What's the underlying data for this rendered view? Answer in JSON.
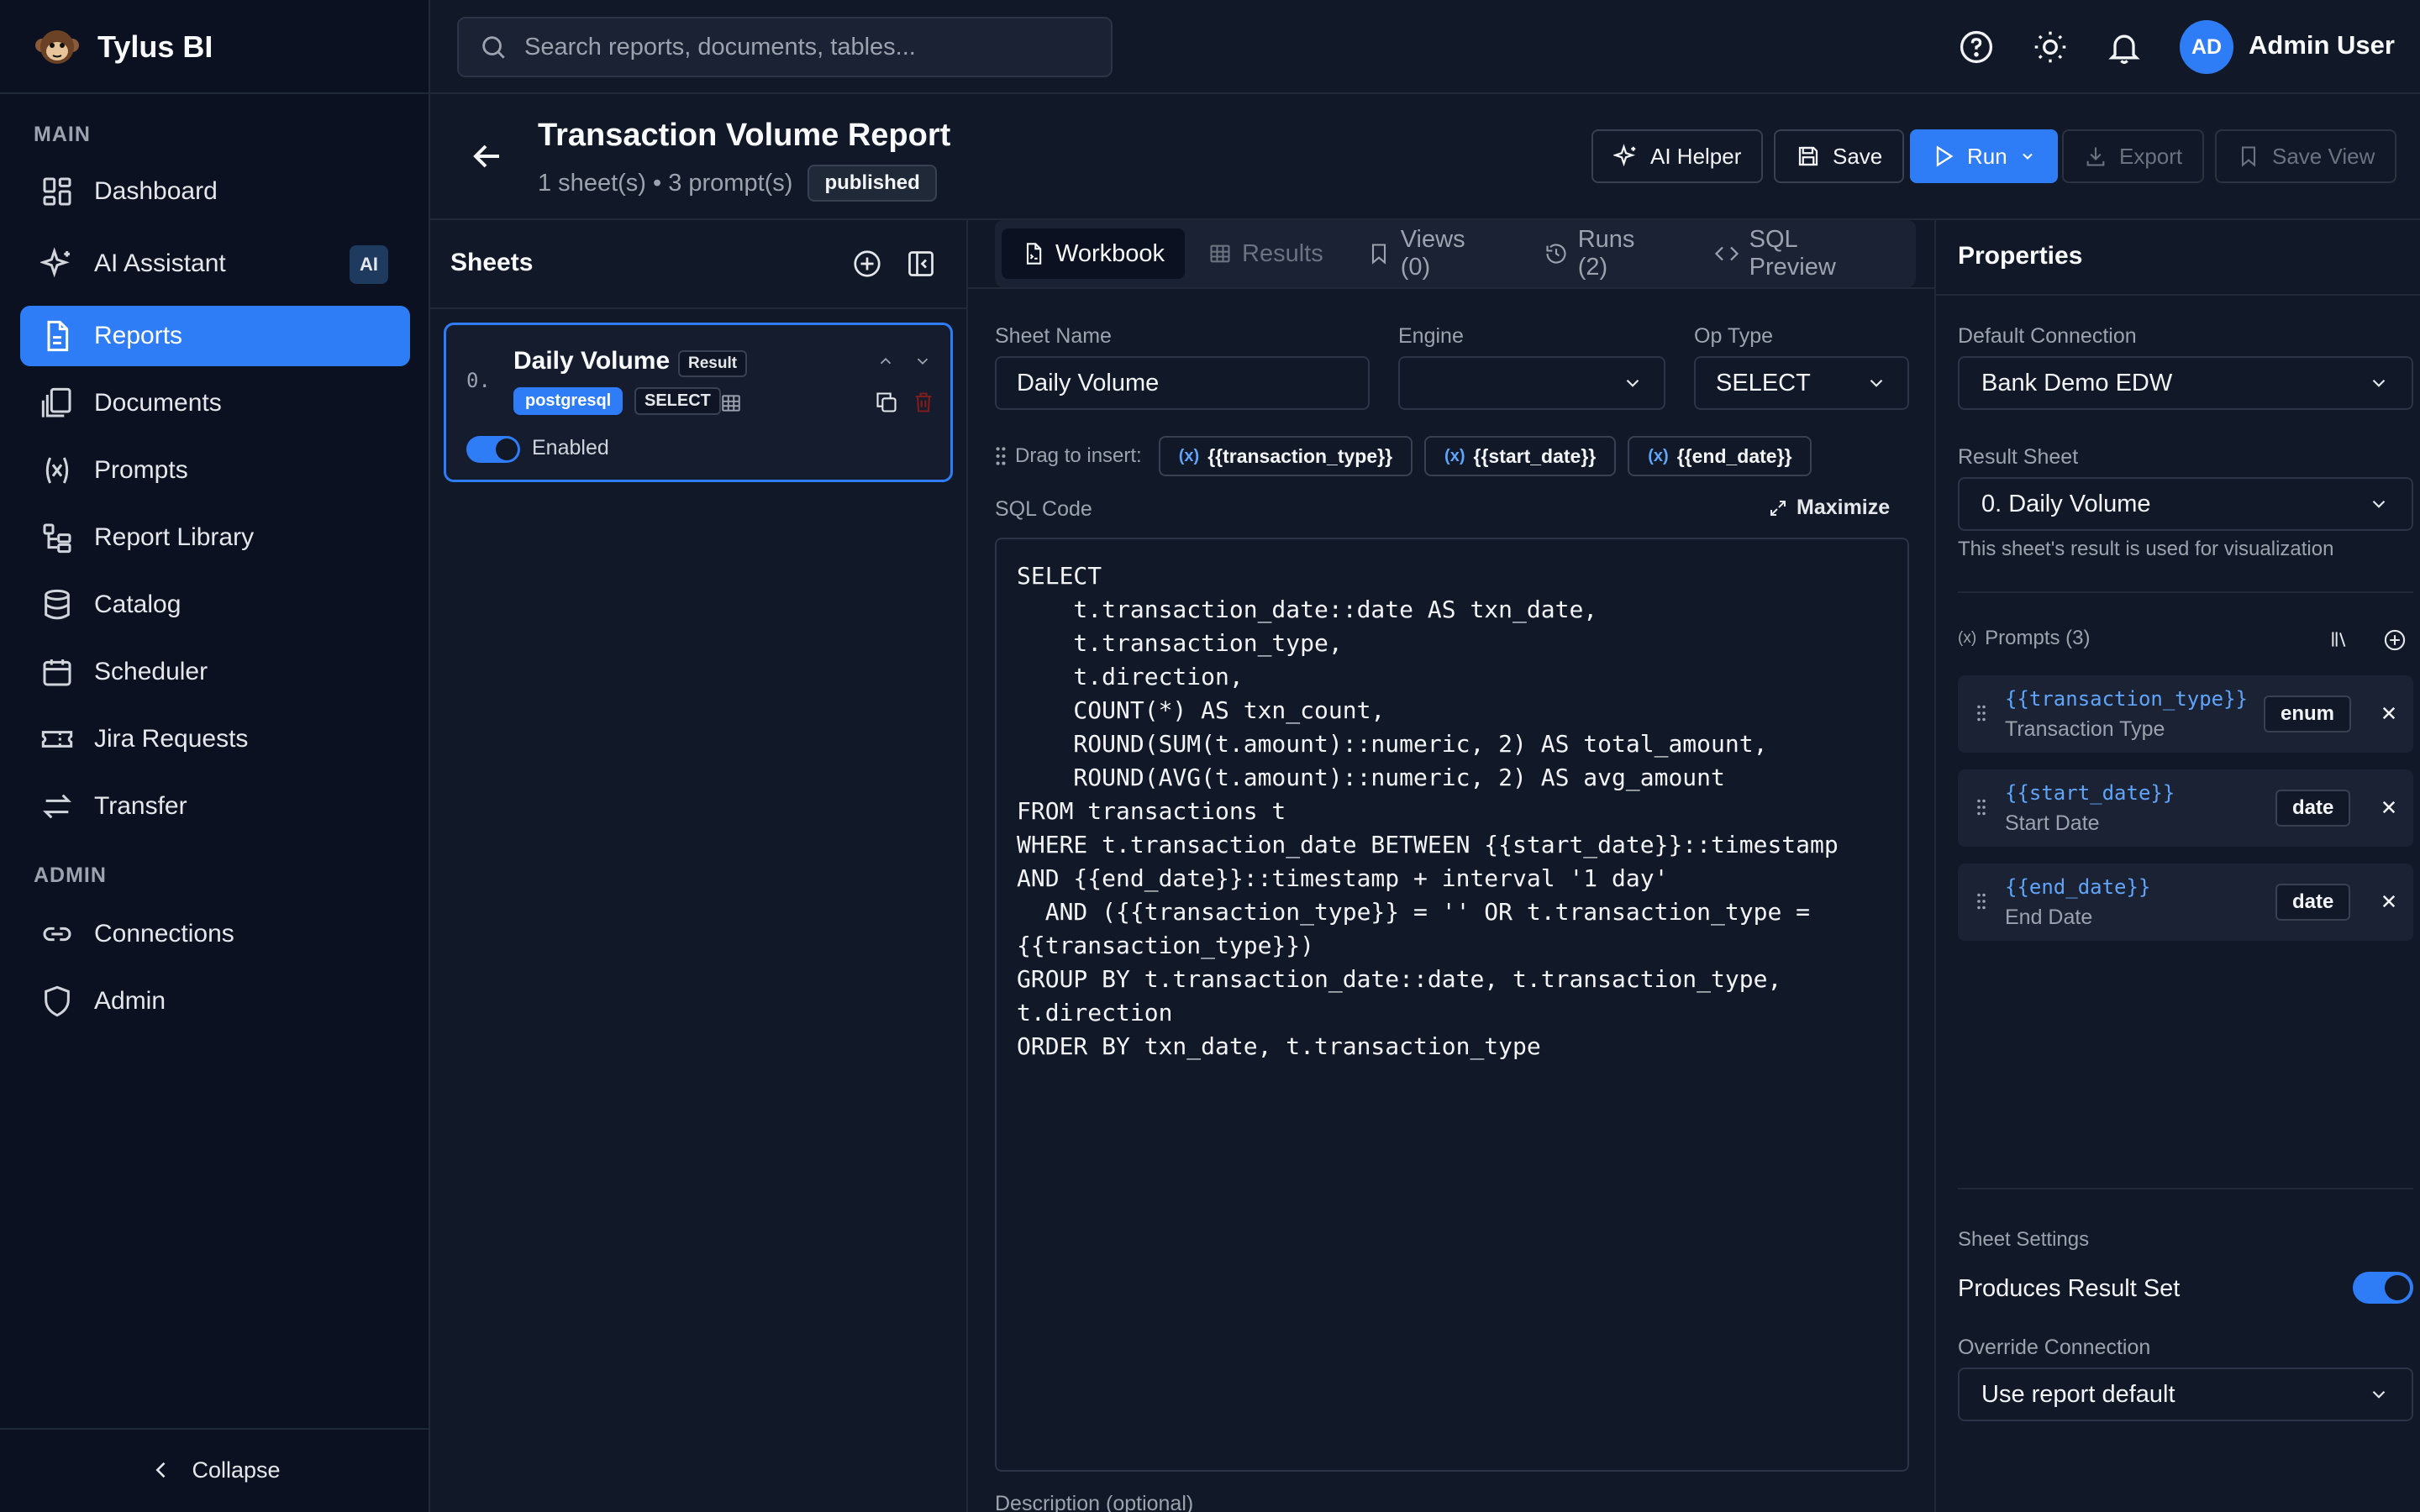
{
  "app": {
    "name": "Tylus BI",
    "logo_icon": "monkey-logo-icon"
  },
  "search": {
    "placeholder": "Search reports, documents, tables..."
  },
  "topbar": {
    "icons": [
      "help-icon",
      "sun-icon",
      "bell-icon"
    ],
    "user": {
      "initials": "AD",
      "name": "Admin User"
    }
  },
  "sidebar": {
    "sections": [
      {
        "title": "MAIN"
      },
      {
        "title": "ADMIN"
      }
    ],
    "items": [
      {
        "label": "Dashboard",
        "icon": "dashboard-icon"
      },
      {
        "label": "AI Assistant",
        "icon": "sparkles-icon",
        "badge": "AI"
      },
      {
        "label": "Reports",
        "icon": "report-icon",
        "active": true
      },
      {
        "label": "Documents",
        "icon": "documents-icon"
      },
      {
        "label": "Prompts",
        "icon": "variable-icon"
      },
      {
        "label": "Report Library",
        "icon": "library-icon"
      },
      {
        "label": "Catalog",
        "icon": "database-icon"
      },
      {
        "label": "Scheduler",
        "icon": "calendar-icon"
      },
      {
        "label": "Jira Requests",
        "icon": "ticket-icon"
      },
      {
        "label": "Transfer",
        "icon": "transfer-icon"
      },
      {
        "label": "Connections",
        "icon": "link-icon"
      },
      {
        "label": "Admin",
        "icon": "shield-icon"
      }
    ],
    "collapse_label": "Collapse"
  },
  "report": {
    "title": "Transaction Volume Report",
    "meta": "1 sheet(s) • 3 prompt(s)",
    "status": "published",
    "actions": {
      "ai_helper": "AI Helper",
      "save": "Save",
      "run": "Run",
      "export": "Export",
      "save_view": "Save View"
    }
  },
  "sheets": {
    "title": "Sheets",
    "items": [
      {
        "index": "0.",
        "name": "Daily Volume",
        "result_tag": "Result",
        "engine": "postgresql",
        "op_type": "SELECT",
        "enabled_label": "Enabled",
        "enabled": true
      }
    ]
  },
  "workbook": {
    "tabs": [
      {
        "label": "Workbook",
        "icon": "file-icon",
        "active": true
      },
      {
        "label": "Results",
        "icon": "table-icon",
        "disabled": true
      },
      {
        "label": "Views (0)",
        "icon": "bookmark-icon"
      },
      {
        "label": "Runs (2)",
        "icon": "history-icon"
      },
      {
        "label": "SQL Preview",
        "icon": "code-icon"
      }
    ],
    "fields": {
      "sheet_name_label": "Sheet Name",
      "sheet_name_value": "Daily Volume",
      "engine_label": "Engine",
      "engine_value": "",
      "op_type_label": "Op Type",
      "op_type_value": "SELECT"
    },
    "insert": {
      "label": "Drag to insert:",
      "chips": [
        "{{transaction_type}}",
        "{{start_date}}",
        "{{end_date}}"
      ]
    },
    "sql_label": "SQL Code",
    "maximize_label": "Maximize",
    "sql_code": "SELECT\n    t.transaction_date::date AS txn_date,\n    t.transaction_type,\n    t.direction,\n    COUNT(*) AS txn_count,\n    ROUND(SUM(t.amount)::numeric, 2) AS total_amount,\n    ROUND(AVG(t.amount)::numeric, 2) AS avg_amount\nFROM transactions t\nWHERE t.transaction_date BETWEEN {{start_date}}::timestamp\nAND {{end_date}}::timestamp + interval '1 day'\n  AND ({{transaction_type}} = '' OR t.transaction_type =\n{{transaction_type}})\nGROUP BY t.transaction_date::date, t.transaction_type,\nt.direction\nORDER BY txn_date, t.transaction_type",
    "description_label": "Description (optional)"
  },
  "properties": {
    "title": "Properties",
    "default_connection_label": "Default Connection",
    "default_connection_value": "Bank Demo EDW",
    "result_sheet_label": "Result Sheet",
    "result_sheet_value": "0. Daily Volume",
    "result_sheet_hint": "This sheet's result is used for visualization",
    "prompts_label": "Prompts (3)",
    "prompts": [
      {
        "var": "{{transaction_type}}",
        "label": "Transaction Type",
        "type": "enum"
      },
      {
        "var": "{{start_date}}",
        "label": "Start Date",
        "type": "date"
      },
      {
        "var": "{{end_date}}",
        "label": "End Date",
        "type": "date"
      }
    ],
    "sheet_settings_label": "Sheet Settings",
    "produces_result_set_label": "Produces Result Set",
    "produces_result_set": true,
    "override_connection_label": "Override Connection",
    "override_connection_value": "Use report default"
  },
  "colors": {
    "accent": "#2f7df6",
    "background": "#111827",
    "sidebar": "#0b1120",
    "variable": "#60a5fa",
    "danger": "#dc2626"
  }
}
